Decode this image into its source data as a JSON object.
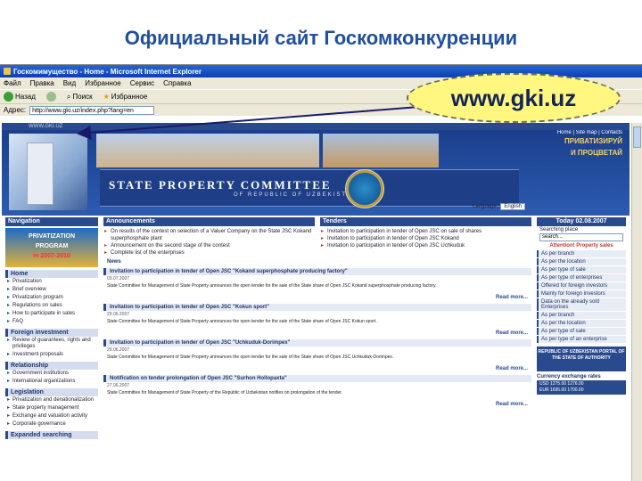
{
  "slide_title": "Официальный сайт Госкомконкуренции",
  "callout_url": "www.gki.uz",
  "browser": {
    "window_title": "Госкомимущество - Home - Microsoft Internet Explorer",
    "menu": [
      "Файл",
      "Правка",
      "Вид",
      "Избранное",
      "Сервис",
      "Справка"
    ],
    "toolbar": [
      "Назад",
      "Поиск",
      "Избранное"
    ],
    "address_label": "Адрес:",
    "address_value": "http://www.gki.uz/index.php?lang=en"
  },
  "site": {
    "top_url": "WWW.GKI.UZ",
    "name_line1": "STATE PROPERTY COMMITTEE",
    "name_line2": "OF REPUBLIC OF UZBEKISTAN",
    "tagline": [
      "ПРИВАТИЗИРУЙ",
      "И ПРОЦВЕТАЙ"
    ],
    "top_nav": "Home  |  Site map  |  Contacts"
  },
  "left": {
    "nav_title": "Navigation",
    "promo_line1": "PRIVATIZATION",
    "promo_line2": "PROGRAM",
    "promo_years": "in 2007-2010",
    "sections": [
      {
        "title": "Home",
        "items": [
          "Privatization",
          "Brief overview",
          "Privatization program",
          "Regulations on sales",
          "How to participate in sales",
          "FAQ"
        ]
      },
      {
        "title": "Foreign investment",
        "items": [
          "Review of guarantees, rights and privileges",
          "Investment proposals"
        ]
      },
      {
        "title": "Relationship",
        "items": [
          "Government institutions",
          "International organizations"
        ]
      },
      {
        "title": "Legislation",
        "items": [
          "Privatization and denationalization",
          "State property management",
          "Exchange and valuation activity",
          "Corporate governance"
        ]
      },
      {
        "title": "Expanded searching",
        "items": []
      }
    ]
  },
  "center": {
    "announcements_title": "Announcements",
    "tenders_title": "Tenders",
    "announcements": [
      "On results of the contest on selection of a Valuer Company on the State JSC Kokand superphosphate plant",
      "Announcement on the second stage of the contest",
      "Complete list of the enterprises"
    ],
    "tenders": [
      "Invitation to participation in tender of Open JSC on sale of shares",
      "Invitation to participation in tender of Open JSC Kokand",
      "Invitation to participation in tender of Open JSC Uchkuduk"
    ],
    "news_label": "News",
    "read_more": "Read more...",
    "news": [
      {
        "title": "Invitation to participation in tender of Open JSC \"Kokand superphosphate producing factory\"",
        "date": "03.07.2007",
        "body": "State Committee for Management of State Property announces the open tender for the sale of the State share of Open JSC Kokand superphosphate producing factory."
      },
      {
        "title": "Invitation to participation in tender of Open JSC \"Kokun sport\"",
        "date": "29.06.2007",
        "body": "State Committee for Management of State Property announces the open tender for the sale of the State share of Open JSC Kokun sport."
      },
      {
        "title": "Invitation to participation in tender of Open JSC \"Uchkuduk-Dorimpex\"",
        "date": "29.06.2007",
        "body": "State Committee for Management of State Property announces the open tender for the sale of the State share of Open JSC Uchkuduk-Dorimpex."
      },
      {
        "title": "Notification on tender prolongation of Open JSC \"Surhon Hollopaxta\"",
        "date": "27.06.2007",
        "body": "State Committee for Management of State Property of the Republic of Uzbekistan notifies on prolongation of the tender."
      }
    ]
  },
  "right": {
    "language_label": "Language:",
    "language_value": "English",
    "date": "Today 02.08.2007",
    "search_label": "Searching place",
    "search_value": "search...",
    "attention": "Attention! Property sales",
    "items": [
      "As per branch",
      "As per the location",
      "As per type of sale",
      "As per type of enterprises",
      "Offered for foreign investors",
      "Mainly for foreign investors",
      "Data on the already sold Enterprises",
      "As per branch",
      "As per the location",
      "As per type of sale",
      "As per type of an enterprise"
    ],
    "portal": "REPUBLIC OF UZBEKISTAN PORTAL OF THE STATE OF AUTHORITY",
    "currency_title": "Currency exchange rates",
    "rates": [
      "USD 1275.00  1276.00",
      "EUR 1695.00  1700.00"
    ]
  }
}
